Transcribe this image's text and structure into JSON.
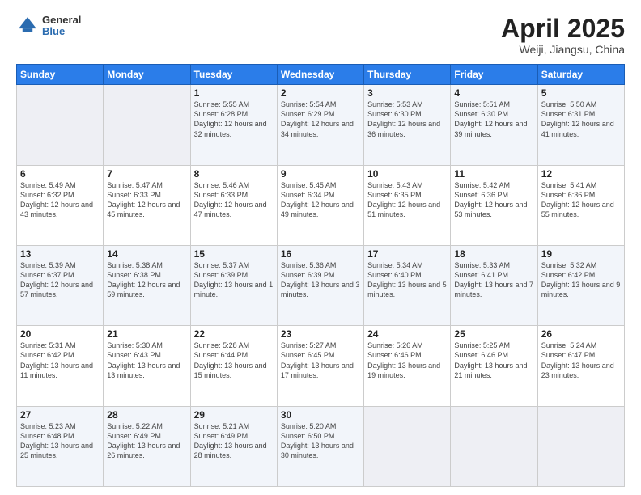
{
  "header": {
    "logo_general": "General",
    "logo_blue": "Blue",
    "title": "April 2025",
    "subtitle": "Weiji, Jiangsu, China"
  },
  "weekdays": [
    "Sunday",
    "Monday",
    "Tuesday",
    "Wednesday",
    "Thursday",
    "Friday",
    "Saturday"
  ],
  "weeks": [
    [
      {
        "day": "",
        "info": ""
      },
      {
        "day": "",
        "info": ""
      },
      {
        "day": "1",
        "info": "Sunrise: 5:55 AM\nSunset: 6:28 PM\nDaylight: 12 hours and 32 minutes."
      },
      {
        "day": "2",
        "info": "Sunrise: 5:54 AM\nSunset: 6:29 PM\nDaylight: 12 hours and 34 minutes."
      },
      {
        "day": "3",
        "info": "Sunrise: 5:53 AM\nSunset: 6:30 PM\nDaylight: 12 hours and 36 minutes."
      },
      {
        "day": "4",
        "info": "Sunrise: 5:51 AM\nSunset: 6:30 PM\nDaylight: 12 hours and 39 minutes."
      },
      {
        "day": "5",
        "info": "Sunrise: 5:50 AM\nSunset: 6:31 PM\nDaylight: 12 hours and 41 minutes."
      }
    ],
    [
      {
        "day": "6",
        "info": "Sunrise: 5:49 AM\nSunset: 6:32 PM\nDaylight: 12 hours and 43 minutes."
      },
      {
        "day": "7",
        "info": "Sunrise: 5:47 AM\nSunset: 6:33 PM\nDaylight: 12 hours and 45 minutes."
      },
      {
        "day": "8",
        "info": "Sunrise: 5:46 AM\nSunset: 6:33 PM\nDaylight: 12 hours and 47 minutes."
      },
      {
        "day": "9",
        "info": "Sunrise: 5:45 AM\nSunset: 6:34 PM\nDaylight: 12 hours and 49 minutes."
      },
      {
        "day": "10",
        "info": "Sunrise: 5:43 AM\nSunset: 6:35 PM\nDaylight: 12 hours and 51 minutes."
      },
      {
        "day": "11",
        "info": "Sunrise: 5:42 AM\nSunset: 6:36 PM\nDaylight: 12 hours and 53 minutes."
      },
      {
        "day": "12",
        "info": "Sunrise: 5:41 AM\nSunset: 6:36 PM\nDaylight: 12 hours and 55 minutes."
      }
    ],
    [
      {
        "day": "13",
        "info": "Sunrise: 5:39 AM\nSunset: 6:37 PM\nDaylight: 12 hours and 57 minutes."
      },
      {
        "day": "14",
        "info": "Sunrise: 5:38 AM\nSunset: 6:38 PM\nDaylight: 12 hours and 59 minutes."
      },
      {
        "day": "15",
        "info": "Sunrise: 5:37 AM\nSunset: 6:39 PM\nDaylight: 13 hours and 1 minute."
      },
      {
        "day": "16",
        "info": "Sunrise: 5:36 AM\nSunset: 6:39 PM\nDaylight: 13 hours and 3 minutes."
      },
      {
        "day": "17",
        "info": "Sunrise: 5:34 AM\nSunset: 6:40 PM\nDaylight: 13 hours and 5 minutes."
      },
      {
        "day": "18",
        "info": "Sunrise: 5:33 AM\nSunset: 6:41 PM\nDaylight: 13 hours and 7 minutes."
      },
      {
        "day": "19",
        "info": "Sunrise: 5:32 AM\nSunset: 6:42 PM\nDaylight: 13 hours and 9 minutes."
      }
    ],
    [
      {
        "day": "20",
        "info": "Sunrise: 5:31 AM\nSunset: 6:42 PM\nDaylight: 13 hours and 11 minutes."
      },
      {
        "day": "21",
        "info": "Sunrise: 5:30 AM\nSunset: 6:43 PM\nDaylight: 13 hours and 13 minutes."
      },
      {
        "day": "22",
        "info": "Sunrise: 5:28 AM\nSunset: 6:44 PM\nDaylight: 13 hours and 15 minutes."
      },
      {
        "day": "23",
        "info": "Sunrise: 5:27 AM\nSunset: 6:45 PM\nDaylight: 13 hours and 17 minutes."
      },
      {
        "day": "24",
        "info": "Sunrise: 5:26 AM\nSunset: 6:46 PM\nDaylight: 13 hours and 19 minutes."
      },
      {
        "day": "25",
        "info": "Sunrise: 5:25 AM\nSunset: 6:46 PM\nDaylight: 13 hours and 21 minutes."
      },
      {
        "day": "26",
        "info": "Sunrise: 5:24 AM\nSunset: 6:47 PM\nDaylight: 13 hours and 23 minutes."
      }
    ],
    [
      {
        "day": "27",
        "info": "Sunrise: 5:23 AM\nSunset: 6:48 PM\nDaylight: 13 hours and 25 minutes."
      },
      {
        "day": "28",
        "info": "Sunrise: 5:22 AM\nSunset: 6:49 PM\nDaylight: 13 hours and 26 minutes."
      },
      {
        "day": "29",
        "info": "Sunrise: 5:21 AM\nSunset: 6:49 PM\nDaylight: 13 hours and 28 minutes."
      },
      {
        "day": "30",
        "info": "Sunrise: 5:20 AM\nSunset: 6:50 PM\nDaylight: 13 hours and 30 minutes."
      },
      {
        "day": "",
        "info": ""
      },
      {
        "day": "",
        "info": ""
      },
      {
        "day": "",
        "info": ""
      }
    ]
  ]
}
